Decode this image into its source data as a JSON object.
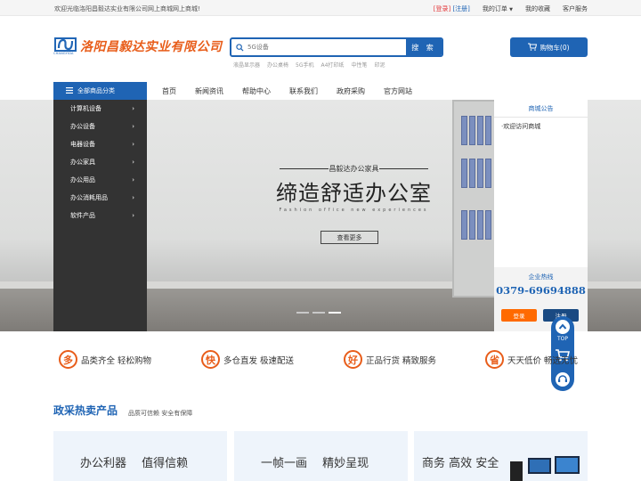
{
  "topbar": {
    "welcome": "欢迎光临洛阳昌毅达实业有限公司网上商城网上商城!",
    "login": "[登录]",
    "register": "[注册]",
    "my_orders": "我的订单",
    "my_favorites": "我的收藏",
    "customer_service": "客户服务"
  },
  "logo": {
    "name": "洛阳昌毅达实业有限公司",
    "sub": "CHANGYIDA"
  },
  "search": {
    "placeholder": "5G设备",
    "button": "搜 索",
    "hot": [
      "液晶显示器",
      "办公桌椅",
      "5G手机",
      "A4打印纸",
      "中性笔",
      "印泥"
    ]
  },
  "cart": {
    "label": "购物车(0)"
  },
  "nav": {
    "all_categories": "全部商品分类",
    "items": [
      "首页",
      "新闻资讯",
      "帮助中心",
      "联系我们",
      "政府采购",
      "官方网站"
    ]
  },
  "categories": [
    "计算机设备",
    "办公设备",
    "电器设备",
    "办公家具",
    "办公用品",
    "办公消耗用品",
    "软件产品"
  ],
  "banner": {
    "small": "昌毅达办公家具",
    "big": "缔造舒适办公室",
    "en": "Fashion office new experiences",
    "more": "查看更多",
    "active_slide": 3,
    "slide_count": 3
  },
  "notice": {
    "title": "商城公告",
    "item": "·欢迎访问商城",
    "hotline_label": "企业热线",
    "phone": "0379-69694888",
    "login": "登录",
    "register": "注册"
  },
  "side": {
    "top": "TOP"
  },
  "features": [
    {
      "badge": "多",
      "text": "品类齐全 轻松购物"
    },
    {
      "badge": "快",
      "text": "多仓直发 极速配送"
    },
    {
      "badge": "好",
      "text": "正品行货 精致服务"
    },
    {
      "badge": "省",
      "text": "天天低价 畅选无忧"
    }
  ],
  "section": {
    "title": "政采热卖产品",
    "subtitle": "品质可信赖 安全有保障"
  },
  "cards": [
    "办公利器　 值得信赖",
    "一帧一画　 精妙呈现",
    "商务 高效 安全"
  ]
}
